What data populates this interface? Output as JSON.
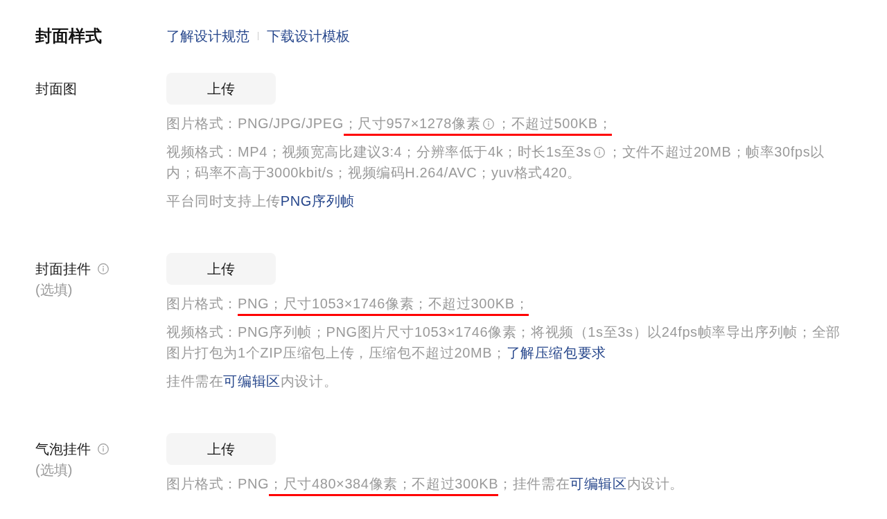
{
  "header": {
    "title": "封面样式",
    "links": [
      "了解设计规范",
      "下载设计模板"
    ]
  },
  "sections": [
    {
      "label": "封面图",
      "info_icon": false,
      "button": "上传",
      "notes": [
        {
          "parts": [
            {
              "kind": "text",
              "text": "图片格式：PNG/JPG/JPEG",
              "underlined": false
            },
            {
              "kind": "text",
              "text": "；尺寸957×1278像素",
              "underlined": true
            },
            {
              "kind": "info",
              "underlined": true
            },
            {
              "kind": "text",
              "text": "；不超过500KB；",
              "underlined": true
            }
          ]
        },
        {
          "parts": [
            {
              "kind": "text",
              "text": "视频格式：MP4；视频宽高比建议3:4；分辨率低于4k；时长1s至3s",
              "underlined": false
            },
            {
              "kind": "info",
              "underlined": false
            },
            {
              "kind": "text",
              "text": "；文件不超过20MB；帧率30fps以内；码率不高于3000kbit/s；视频编码H.264/AVC；yuv格式420。",
              "underlined": false
            }
          ]
        },
        {
          "parts": [
            {
              "kind": "text",
              "text": "平台同时支持上传",
              "underlined": false
            },
            {
              "kind": "link",
              "text": "PNG序列帧",
              "underlined": false
            }
          ]
        }
      ]
    },
    {
      "label": "封面挂件",
      "info_icon": true,
      "hint": "(选填)",
      "button": "上传",
      "notes": [
        {
          "parts": [
            {
              "kind": "text",
              "text": "图片格式：",
              "underlined": false
            },
            {
              "kind": "text",
              "text": "PNG；尺寸1053×1746像素；不超过300KB；",
              "underlined": true
            }
          ]
        },
        {
          "parts": [
            {
              "kind": "text",
              "text": "视频格式：PNG序列帧；PNG图片尺寸1053×1746像素；将视频（1s至3s）以24fps帧率导出序列帧；全部图片打包为1个ZIP压缩包上传，压缩包不超过20MB；",
              "underlined": false
            },
            {
              "kind": "link",
              "text": "了解压缩包要求",
              "underlined": false
            }
          ]
        },
        {
          "parts": [
            {
              "kind": "text",
              "text": "挂件需在",
              "underlined": false
            },
            {
              "kind": "link",
              "text": "可编辑区",
              "underlined": false
            },
            {
              "kind": "text",
              "text": "内设计。",
              "underlined": false
            }
          ]
        }
      ]
    },
    {
      "label": "气泡挂件",
      "info_icon": true,
      "hint": "(选填)",
      "button": "上传",
      "notes": [
        {
          "parts": [
            {
              "kind": "text",
              "text": "图片格式：PNG",
              "underlined": false
            },
            {
              "kind": "text",
              "text": "；尺寸480×384像素；不超过300KB",
              "underlined": true
            },
            {
              "kind": "text",
              "text": "；挂件需在",
              "underlined": false
            },
            {
              "kind": "link",
              "text": "可编辑区",
              "underlined": false
            },
            {
              "kind": "text",
              "text": "内设计。",
              "underlined": false
            }
          ]
        }
      ]
    }
  ]
}
